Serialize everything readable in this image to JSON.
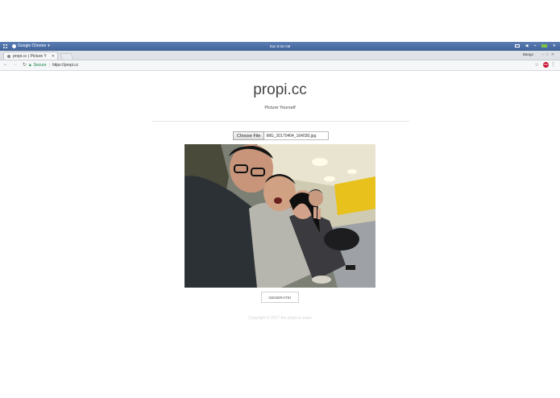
{
  "os_bar": {
    "app_label": "Google Chrome",
    "time": "Sun 8:16 AM"
  },
  "tab": {
    "title": "propi.cc | Picture Y"
  },
  "browser": {
    "profile_name": "Bango",
    "secure_label": "Secure",
    "url": "https://propi.cc"
  },
  "page": {
    "title": "propi.cc",
    "subtitle": "Picture Yourself",
    "file_button_label": "Choose File",
    "file_name": "IMG_20170404_164030.jpg",
    "generate_label": "GENERATE!",
    "footer": "Copyright © 2017 the propi.cc team"
  }
}
